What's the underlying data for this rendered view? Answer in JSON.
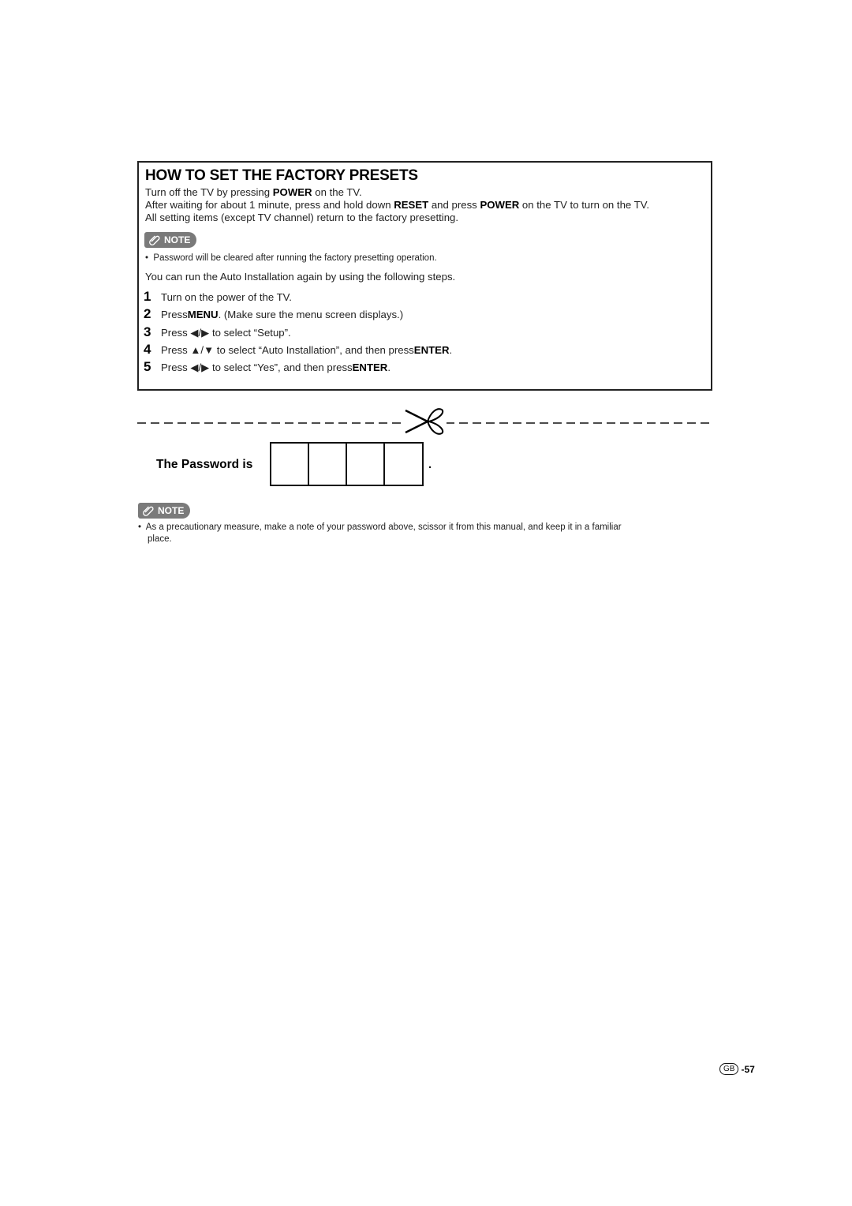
{
  "section": {
    "title": "HOW TO SET THE FACTORY PRESETS",
    "para1": {
      "pre": "Turn off the TV by pressing ",
      "b1": "POWER",
      "post": " on the TV."
    },
    "para2": {
      "pre": "After waiting for about 1 minute, press and hold down ",
      "b1": "RESET",
      "mid": " and press ",
      "b2": "POWER",
      "post": " on the TV to turn on the TV."
    },
    "para3": "All setting items (except TV channel) return to the factory presetting.",
    "note_label": "NOTE",
    "note_text": "Password will be cleared after running the factory presetting operation.",
    "intro": "You can run the Auto Installation again by using the following steps.",
    "steps": [
      {
        "num": "1",
        "pre": "Turn on the power of the TV.",
        "bold": "",
        "post": ""
      },
      {
        "num": "2",
        "pre": "Press ",
        "bold": "MENU",
        "post": ". (Make sure the menu screen displays.)"
      },
      {
        "num": "3",
        "pre": "Press ◀/▶ to select “Setup”.",
        "bold": "",
        "post": ""
      },
      {
        "num": "4",
        "pre": "Press ▲/▼ to select “Auto Installation”, and then press ",
        "bold": "ENTER",
        "post": "."
      },
      {
        "num": "5",
        "pre": "Press ◀/▶ to select “Yes”, and then press ",
        "bold": "ENTER",
        "post": "."
      }
    ]
  },
  "cutout": {
    "password_label": "The Password is",
    "password_cells": [
      "",
      "",
      "",
      ""
    ],
    "end_mark": ".",
    "note_label": "NOTE",
    "note_line1": "As a precautionary measure, make a note of your password above, scissor it from this manual,  and keep it in a familiar",
    "note_line2": "place."
  },
  "footer": {
    "region": "GB",
    "page": "-57"
  }
}
